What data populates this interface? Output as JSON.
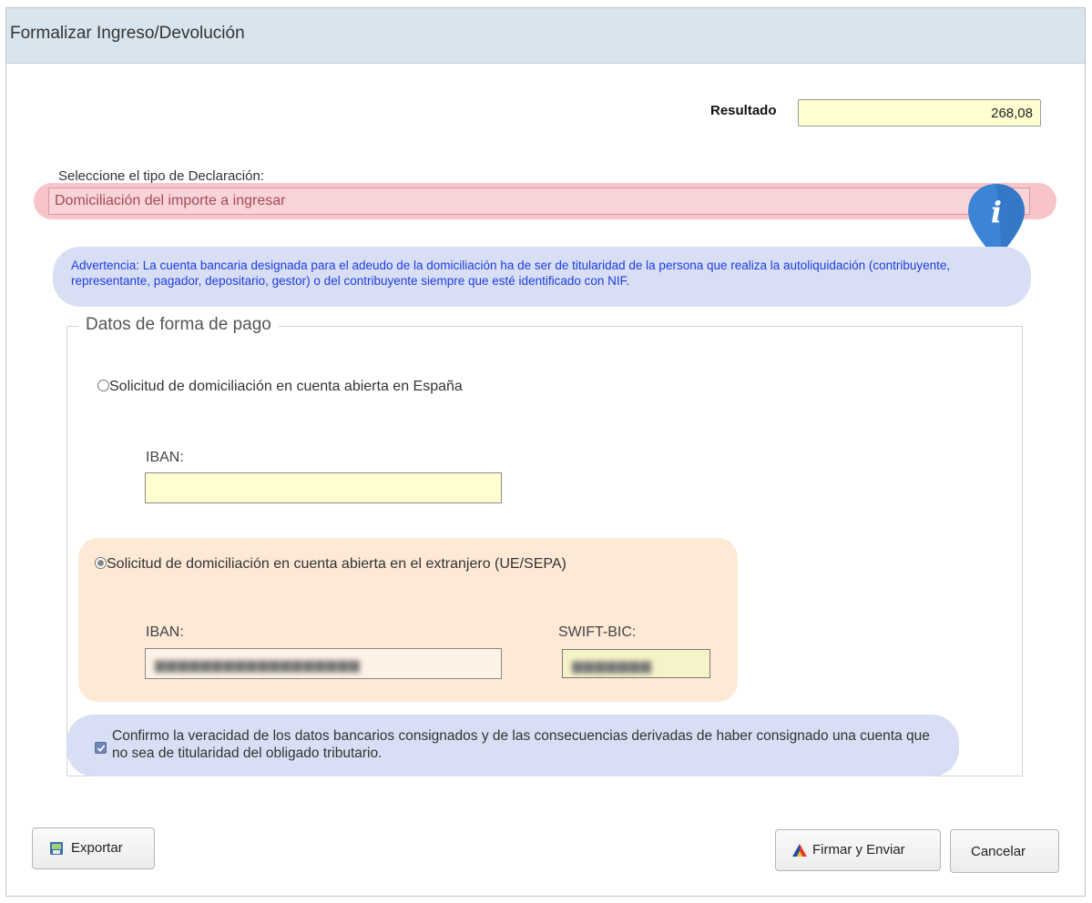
{
  "dialog": {
    "title": "Formalizar Ingreso/Devolución"
  },
  "resultado": {
    "label": "Resultado",
    "value": "268,08"
  },
  "declaracion": {
    "label": "Seleccione el tipo de Declaración:",
    "selected": "Domiciliación del importe a ingresar"
  },
  "warning": {
    "text": "Advertencia: La cuenta bancaria designada para el adeudo de la domiciliación ha de ser de titularidad de la persona que realiza la autoliquidación (contribuyente, representante, pagador, depositario, gestor) o del contribuyente siempre que esté identificado con NIF."
  },
  "payment": {
    "legend": "Datos de forma de pago",
    "option_spain": {
      "label": "Solicitud de domiciliación en cuenta abierta en España",
      "selected": false,
      "iban_label": "IBAN:",
      "iban_value": ""
    },
    "option_foreign": {
      "label": "Solicitud de domiciliación en cuenta abierta en el extranjero (UE/SEPA)",
      "selected": true,
      "iban_label": "IBAN:",
      "swift_label": "SWIFT-BIC:"
    },
    "confirm": {
      "text": "Confirmo la veracidad de los datos bancarios consignados y de las consecuencias derivadas de haber consignado una cuenta que no sea de titularidad del obligado tributario.",
      "checked": true
    }
  },
  "buttons": {
    "exportar": "Exportar",
    "firmar": "Firmar y Enviar",
    "cancelar": "Cancelar"
  },
  "colors": {
    "titlebar": "#d9e5ee",
    "required_field": "#fffed0",
    "error_highlight": "#f7c5c9",
    "info_panel": "#d8def4",
    "warning_text": "#1f3de0",
    "foreign_panel": "#fde9d5",
    "info_pin": "#3b84d6"
  }
}
